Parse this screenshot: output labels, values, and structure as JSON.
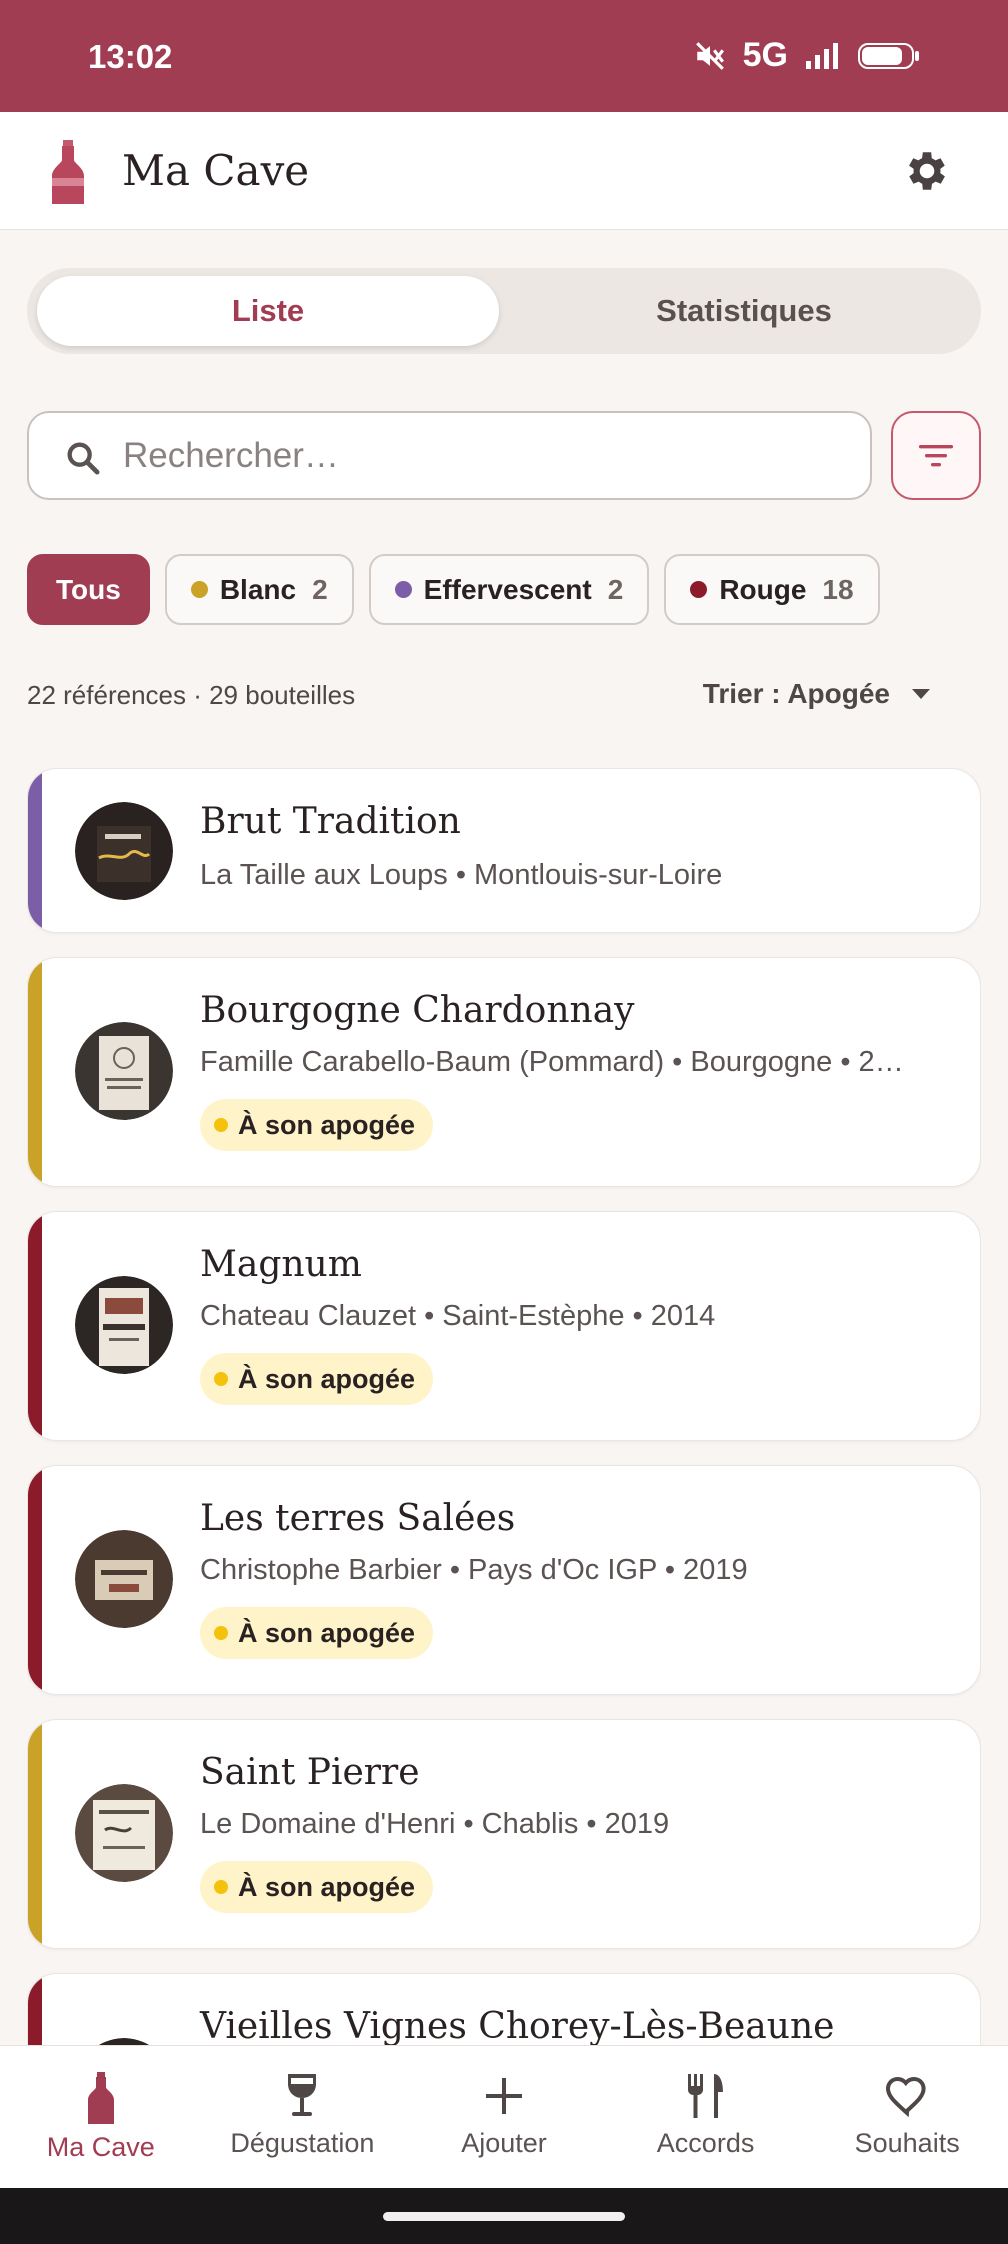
{
  "status_bar": {
    "time": "13:02",
    "network": "5G"
  },
  "app_bar": {
    "title": "Ma Cave"
  },
  "view_tabs": [
    {
      "label": "Liste",
      "active": true
    },
    {
      "label": "Statistiques",
      "active": false
    }
  ],
  "search": {
    "placeholder": "Rechercher…",
    "value": ""
  },
  "filters": [
    {
      "label": "Tous",
      "count": "",
      "active": true,
      "color": ""
    },
    {
      "label": "Blanc",
      "count": "2",
      "active": false,
      "color": "#c9a227"
    },
    {
      "label": "Effervescent",
      "count": "2",
      "active": false,
      "color": "#7b5ea7"
    },
    {
      "label": "Rouge",
      "count": "18",
      "active": false,
      "color": "#8b1a2b"
    }
  ],
  "summary": "22 références · 29 bouteilles",
  "sort": {
    "label": "Trier : Apogée"
  },
  "wines": [
    {
      "name": "Brut Tradition",
      "subtitle": "La Taille aux Loups • Montlouis-sur-Loire",
      "badge": "",
      "color": "#7b5ea7"
    },
    {
      "name": "Bourgogne Chardonnay",
      "subtitle": "Famille Carabello-Baum (Pommard) • Bourgogne • 2…",
      "badge": "À son apogée",
      "color": "#c9a227"
    },
    {
      "name": "Magnum",
      "subtitle": "Chateau Clauzet • Saint-Estèphe • 2014",
      "badge": "À son apogée",
      "color": "#8b1a2b"
    },
    {
      "name": "Les terres Salées",
      "subtitle": "Christophe Barbier • Pays d'Oc IGP • 2019",
      "badge": "À son apogée",
      "color": "#8b1a2b"
    },
    {
      "name": "Saint Pierre",
      "subtitle": "Le Domaine d'Henri • Chablis • 2019",
      "badge": "À son apogée",
      "color": "#c9a227"
    },
    {
      "name": "Vieilles Vignes Chorey-Lès-Beaune",
      "subtitle": "",
      "badge": "",
      "color": "#8b1a2b"
    }
  ],
  "bottom_nav": [
    {
      "label": "Ma Cave",
      "icon": "bottle-icon",
      "active": true
    },
    {
      "label": "Dégustation",
      "icon": "wine-glass-icon",
      "active": false
    },
    {
      "label": "Ajouter",
      "icon": "plus-icon",
      "active": false
    },
    {
      "label": "Accords",
      "icon": "fork-knife-icon",
      "active": false
    },
    {
      "label": "Souhaits",
      "icon": "heart-icon",
      "active": false
    }
  ],
  "colors": {
    "accent": "#a03d52",
    "badge_bg": "#fff4c9",
    "badge_dot": "#f4c20d"
  }
}
